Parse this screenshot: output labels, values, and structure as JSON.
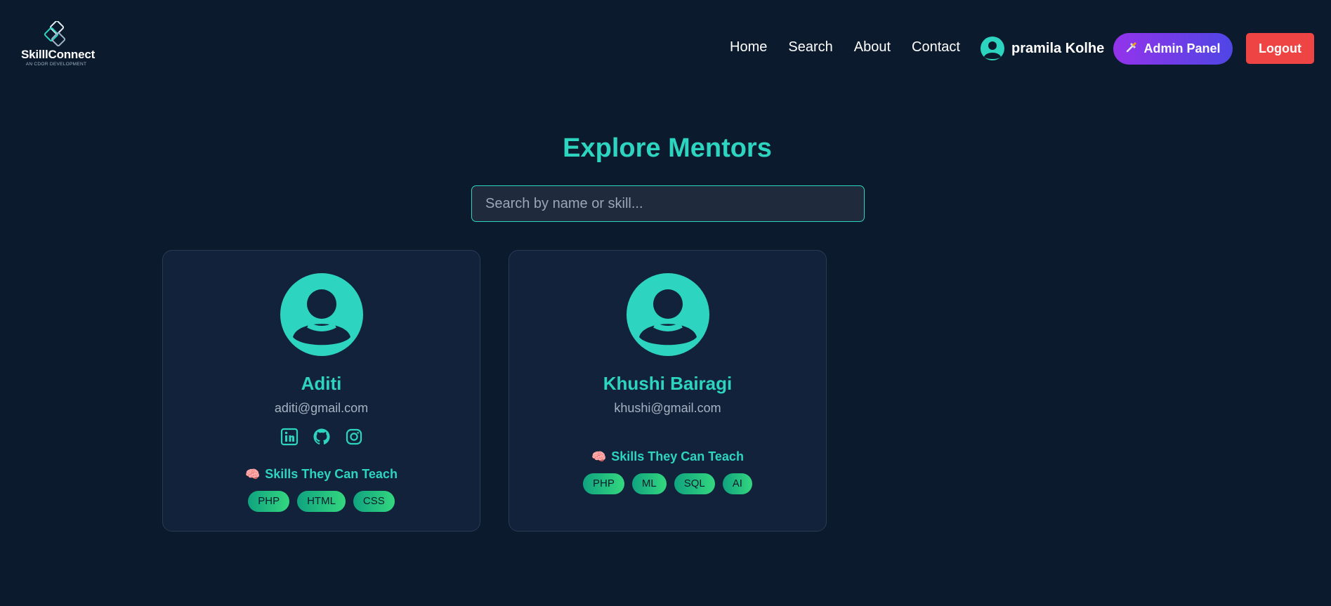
{
  "brand": {
    "name": "SkilllConnect",
    "tagline": "AN CDOR DEVELOPMENT"
  },
  "nav": {
    "links": [
      {
        "label": "Home"
      },
      {
        "label": "Search"
      },
      {
        "label": "About"
      },
      {
        "label": "Contact"
      }
    ],
    "user_name": "pramila Kolhe",
    "admin_label": "Admin Panel",
    "admin_icon": "tools-icon",
    "logout_label": "Logout"
  },
  "main": {
    "title": "Explore Mentors",
    "search_placeholder": "Search by name or skill..."
  },
  "mentors": [
    {
      "name": "Aditi",
      "email": "aditi@gmail.com",
      "socials": [
        "linkedin-icon",
        "github-icon",
        "instagram-icon"
      ],
      "skills_heading": "Skills They Can Teach",
      "skills": [
        "PHP",
        "HTML",
        "CSS"
      ]
    },
    {
      "name": "Khushi Bairagi",
      "email": "khushi@gmail.com",
      "socials": [],
      "skills_heading": "Skills They Can Teach",
      "skills": [
        "PHP",
        "ML",
        "SQL",
        "AI"
      ]
    }
  ],
  "colors": {
    "background": "#0b1a2c",
    "accent": "#2dd4bf",
    "card": "#12223a",
    "logout": "#ef4444",
    "admin_gradient_start": "#9333ea",
    "admin_gradient_end": "#4f46e5"
  }
}
